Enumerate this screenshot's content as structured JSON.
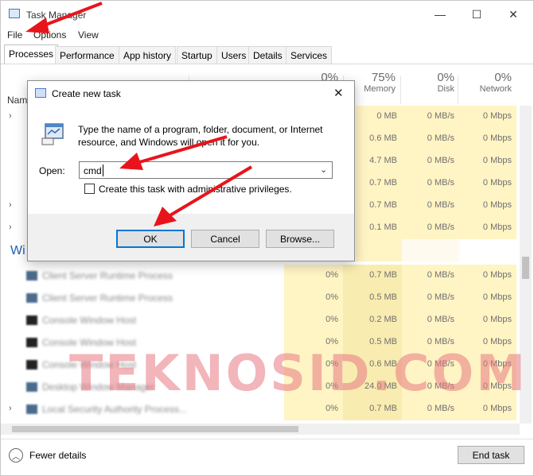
{
  "window": {
    "title": "Task Manager",
    "controls": {
      "minimize": "—",
      "maximize": "☐",
      "close": "✕"
    }
  },
  "menu": [
    "File",
    "Options",
    "View"
  ],
  "tabs": [
    "Processes",
    "Performance",
    "App history",
    "Startup",
    "Users",
    "Details",
    "Services"
  ],
  "active_tab": "Processes",
  "columns": {
    "name": "Name",
    "cpu": {
      "pct": "0%",
      "label": ""
    },
    "memory": {
      "pct": "75%",
      "label": "Memory"
    },
    "disk": {
      "pct": "0%",
      "label": "Disk"
    },
    "network": {
      "pct": "0%",
      "label": "Network"
    }
  },
  "apps_rows": [
    {
      "memory": "0 MB",
      "disk": "0 MB/s",
      "network": "0 Mbps"
    },
    {
      "memory": "0.6 MB",
      "disk": "0 MB/s",
      "network": "0 Mbps"
    },
    {
      "memory": "4.7 MB",
      "disk": "0 MB/s",
      "network": "0 Mbps"
    },
    {
      "memory": "0.7 MB",
      "disk": "0 MB/s",
      "network": "0 Mbps"
    },
    {
      "memory": "0.7 MB",
      "disk": "0 MB/s",
      "network": "0 Mbps"
    },
    {
      "memory": "0.1 MB",
      "disk": "0 MB/s",
      "network": "0 Mbps"
    }
  ],
  "section_header": "Wi",
  "process_rows": [
    {
      "name": "Client Server Runtime Process",
      "cpu": "0%",
      "memory": "0.7 MB",
      "disk": "0 MB/s",
      "network": "0 Mbps"
    },
    {
      "name": "Client Server Runtime Process",
      "cpu": "0%",
      "memory": "0.5 MB",
      "disk": "0 MB/s",
      "network": "0 Mbps"
    },
    {
      "name": "Console Window Host",
      "cpu": "0%",
      "memory": "0.2 MB",
      "disk": "0 MB/s",
      "network": "0 Mbps"
    },
    {
      "name": "Console Window Host",
      "cpu": "0%",
      "memory": "0.5 MB",
      "disk": "0 MB/s",
      "network": "0 Mbps"
    },
    {
      "name": "Console Window Host",
      "cpu": "0%",
      "memory": "0.6 MB",
      "disk": "0 MB/s",
      "network": "0 Mbps"
    },
    {
      "name": "Desktop Window Manager",
      "cpu": "0%",
      "memory": "24.0 MB",
      "disk": "0 MB/s",
      "network": "0 Mbps"
    },
    {
      "name": "Local Security Authority Process...",
      "cpu": "0%",
      "memory": "0.7 MB",
      "disk": "0 MB/s",
      "network": "0 Mbps"
    }
  ],
  "footer": {
    "fewer_details": "Fewer details",
    "end_task": "End task"
  },
  "watermark": "TEKNOSID.COM",
  "dialog": {
    "title": "Create new task",
    "close": "✕",
    "description": "Type the name of a program, folder, document, or Internet resource, and Windows will open it for you.",
    "open_label": "Open:",
    "open_value": "cmd",
    "admin_checkbox_label": "Create this task with administrative privileges.",
    "admin_checked": false,
    "buttons": {
      "ok": "OK",
      "cancel": "Cancel",
      "browse": "Browse..."
    }
  },
  "colors": {
    "accent": "#0078d7",
    "annotation_arrow": "#e8141b",
    "heat_cell": "#fff4c4",
    "section_blue": "#2160b5"
  }
}
